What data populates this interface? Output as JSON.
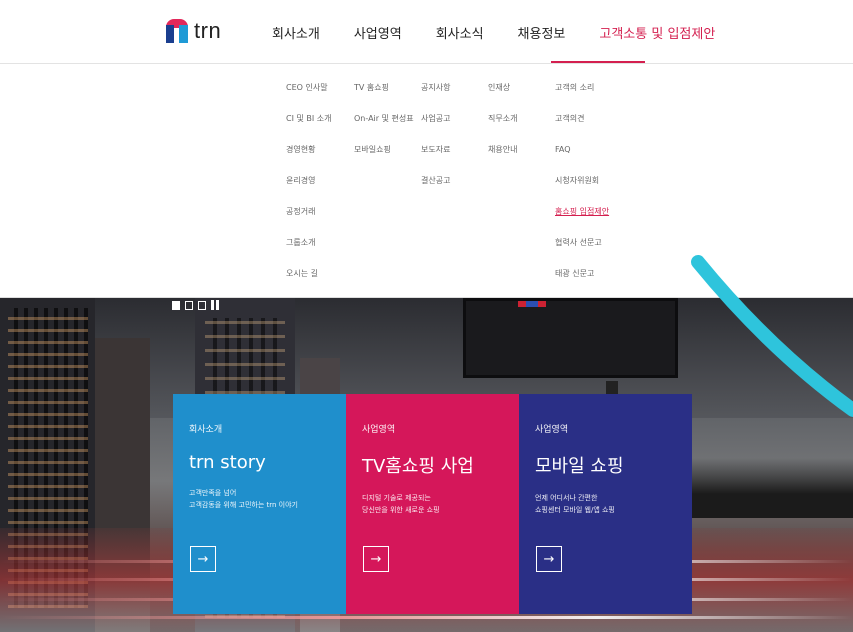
{
  "brand": {
    "logo_text": "trn"
  },
  "nav": [
    {
      "label": "회사소개"
    },
    {
      "label": "사업영역"
    },
    {
      "label": "회사소식"
    },
    {
      "label": "채용정보"
    },
    {
      "label": "고객소통 및 입점제안"
    }
  ],
  "mega_menu": {
    "company": [
      "CEO 인사말",
      "CI 및 BI 소개",
      "경영현황",
      "윤리경영",
      "공정거래",
      "그룹소개",
      "오시는 길"
    ],
    "business": [
      "TV 홈쇼핑",
      "On-Air 및 편성표",
      "모바일쇼핑"
    ],
    "news": [
      "공지사항",
      "사업공고",
      "보도자료",
      "결산공고"
    ],
    "recruit": [
      "인재상",
      "직무소개",
      "채용안내"
    ],
    "customer": [
      "고객의 소리",
      "고객의견",
      "FAQ",
      "시청자위원회",
      "홈쇼핑 입점제안",
      "협력사 선문고",
      "태광 신문고"
    ]
  },
  "slider": {
    "state": "paused"
  },
  "cards": [
    {
      "category": "회사소개",
      "title": "trn story",
      "desc1": "고객만족을 넘어",
      "desc2": "고객감동을 위해 고민하는 trn 이야기",
      "arrow": "→"
    },
    {
      "category": "사업영역",
      "title": "TV홈쇼핑 사업",
      "desc1": "디지털 기술로 제공되는",
      "desc2": "당신만을 위한 새로운 쇼핑",
      "arrow": "→"
    },
    {
      "category": "사업영역",
      "title": "모바일 쇼핑",
      "desc1": "언제 어디서나 간편한",
      "desc2": "쇼핑센터 모바일 웹/앱 쇼핑",
      "arrow": "→"
    }
  ],
  "colors": {
    "accent": "#d41f4f",
    "card_blue": "#1f8fcc",
    "card_red": "#d5175a",
    "card_navy": "#2a2f86",
    "swoosh": "#2ec4dc"
  }
}
